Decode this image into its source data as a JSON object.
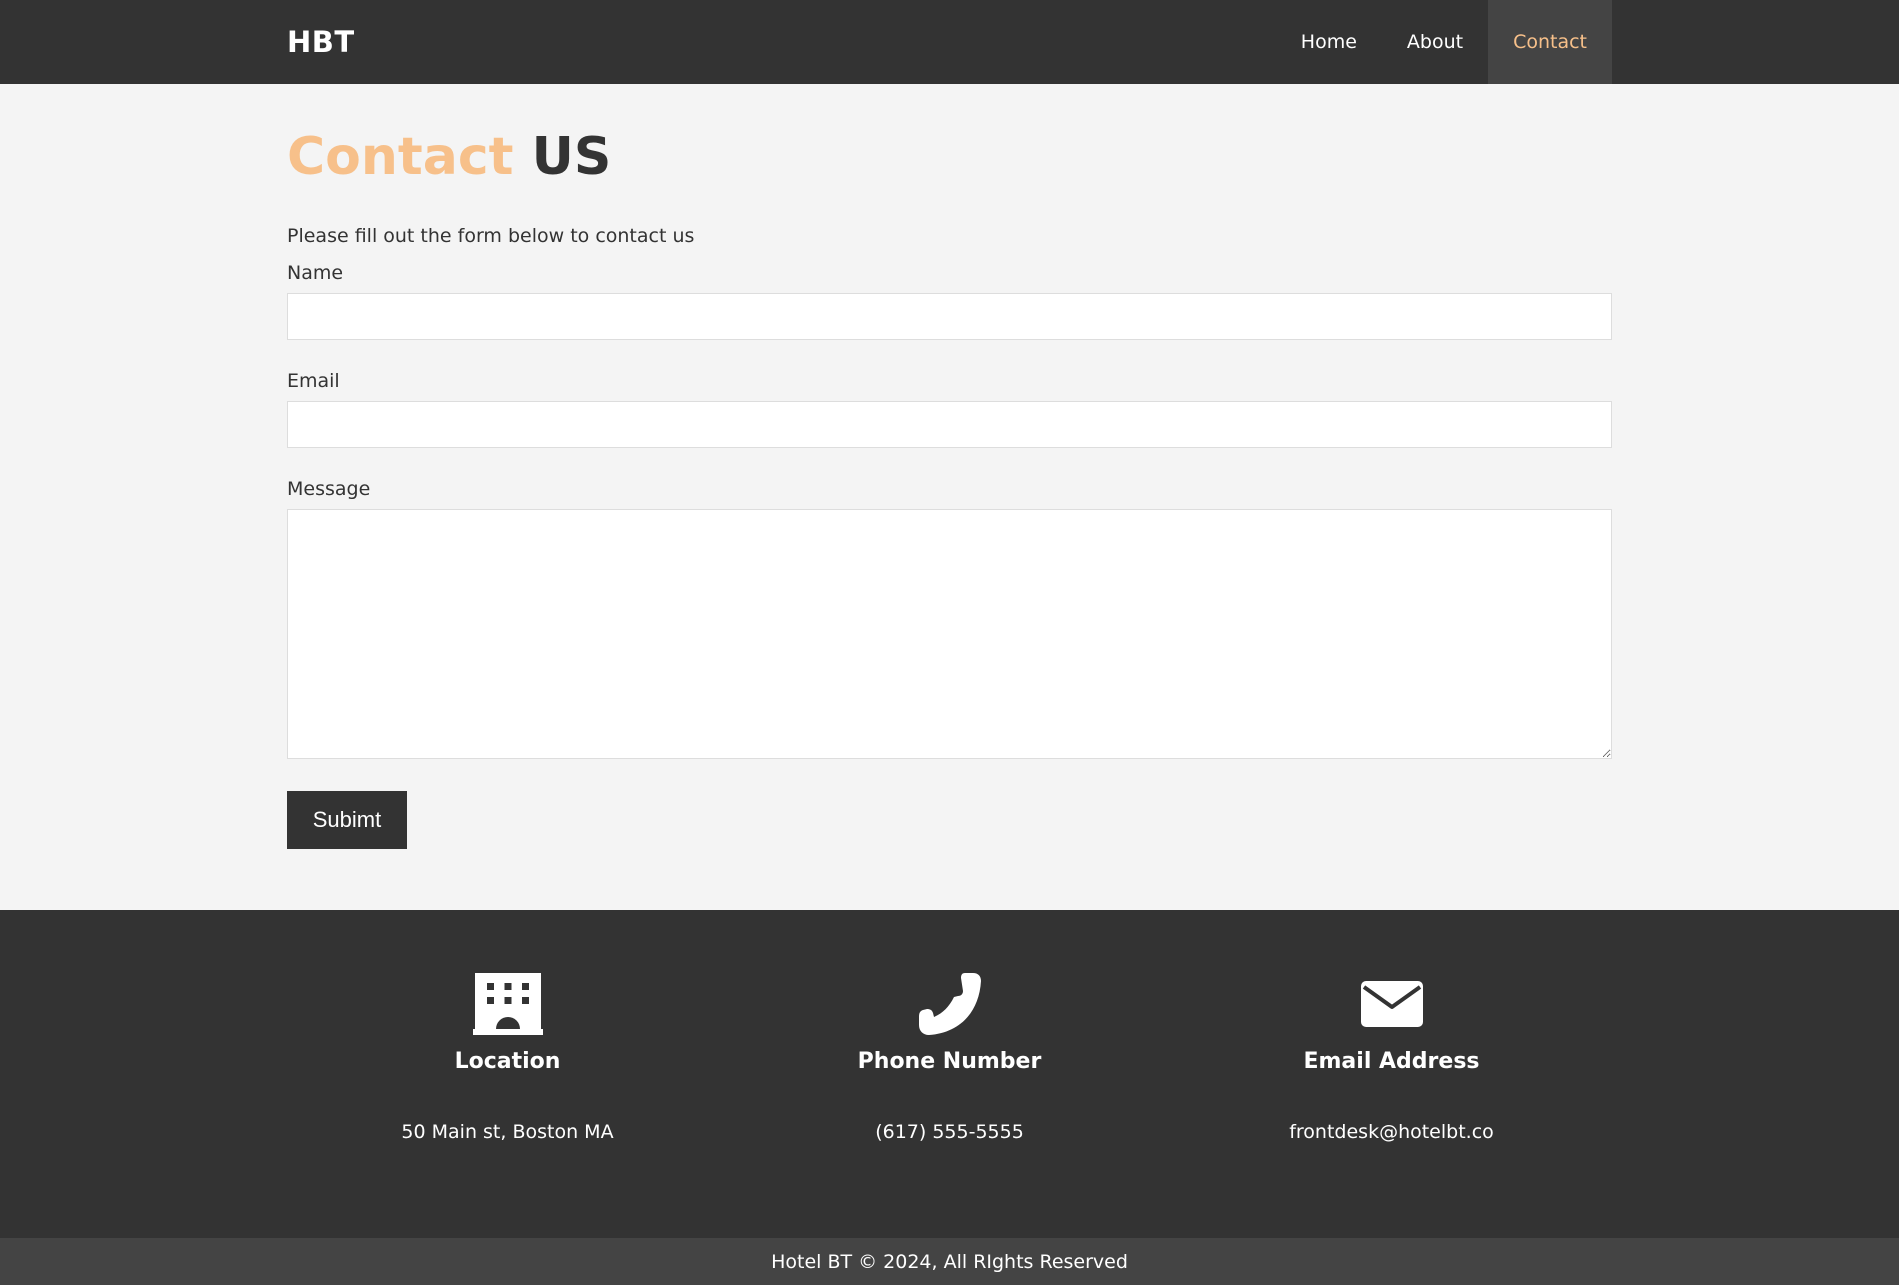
{
  "nav": {
    "brand": "HBT",
    "links": [
      {
        "label": "Home",
        "active": false
      },
      {
        "label": "About",
        "active": false
      },
      {
        "label": "Contact",
        "active": true
      }
    ]
  },
  "heading": {
    "accent": "Contact",
    "rest": "US"
  },
  "form": {
    "intro": "Please fill out the form below to contact us",
    "name_label": "Name",
    "name_value": "",
    "email_label": "Email",
    "email_value": "",
    "message_label": "Message",
    "message_value": "",
    "submit_label": "Subimt"
  },
  "info": [
    {
      "icon": "building-icon",
      "title": "Location",
      "value": "50 Main st, Boston MA"
    },
    {
      "icon": "phone-icon",
      "title": "Phone Number",
      "value": "(617) 555-5555"
    },
    {
      "icon": "envelope-icon",
      "title": "Email Address",
      "value": "frontdesk@hotelbt.co"
    }
  ],
  "copyright": "Hotel BT © 2024, All RIghts Reserved",
  "colors": {
    "dark": "#333333",
    "accent": "#f7c08a",
    "background": "#f4f4f4",
    "footer_bar": "#444444"
  }
}
